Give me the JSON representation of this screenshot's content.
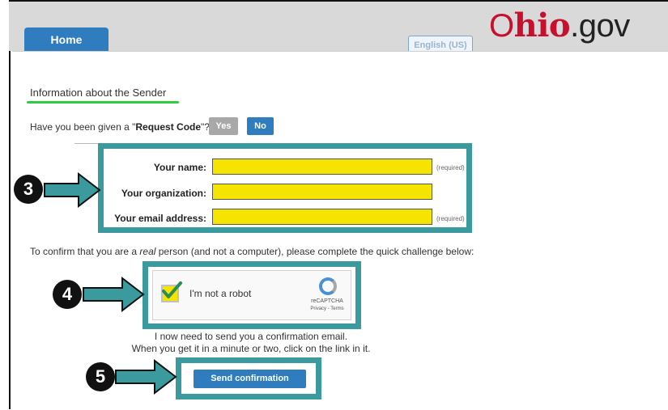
{
  "header": {
    "home_tab": "Home",
    "language_button": "English (US)",
    "logo": {
      "o": "O",
      "hio": "hio",
      "gov": ".gov"
    }
  },
  "sender": {
    "title": "Information about the Sender",
    "request_code_question_prefix": "Have you been given a \"",
    "request_code_bold": "Request Code",
    "request_code_question_suffix": "\"?",
    "yes_label": "Yes",
    "no_label": "No"
  },
  "form": {
    "name_label": "Your name:",
    "org_label": "Your organization:",
    "email_label": "Your email address:",
    "required_note": "(required)",
    "name_value": "",
    "org_value": "",
    "email_value": ""
  },
  "captcha": {
    "prompt_prefix": "To confirm that you are a ",
    "prompt_italic": "real",
    "prompt_suffix": " person (and not a computer), please complete the quick challenge below:",
    "label": "I'm not a robot",
    "brand": "reCAPTCHA",
    "terms": "Privacy - Terms",
    "checked": true
  },
  "confirmation": {
    "line1": "I now need to send you a confirmation email.",
    "line2": "When you get it in a minute or two, click on the link in it.",
    "send_button": "Send confirmation"
  },
  "steps": {
    "three": "3",
    "four": "4",
    "five": "5"
  },
  "colors": {
    "highlight": "#3a9a9d",
    "accent": "#2f7dbf",
    "field_highlight": "#f5e400",
    "underline": "#2ecc40"
  }
}
